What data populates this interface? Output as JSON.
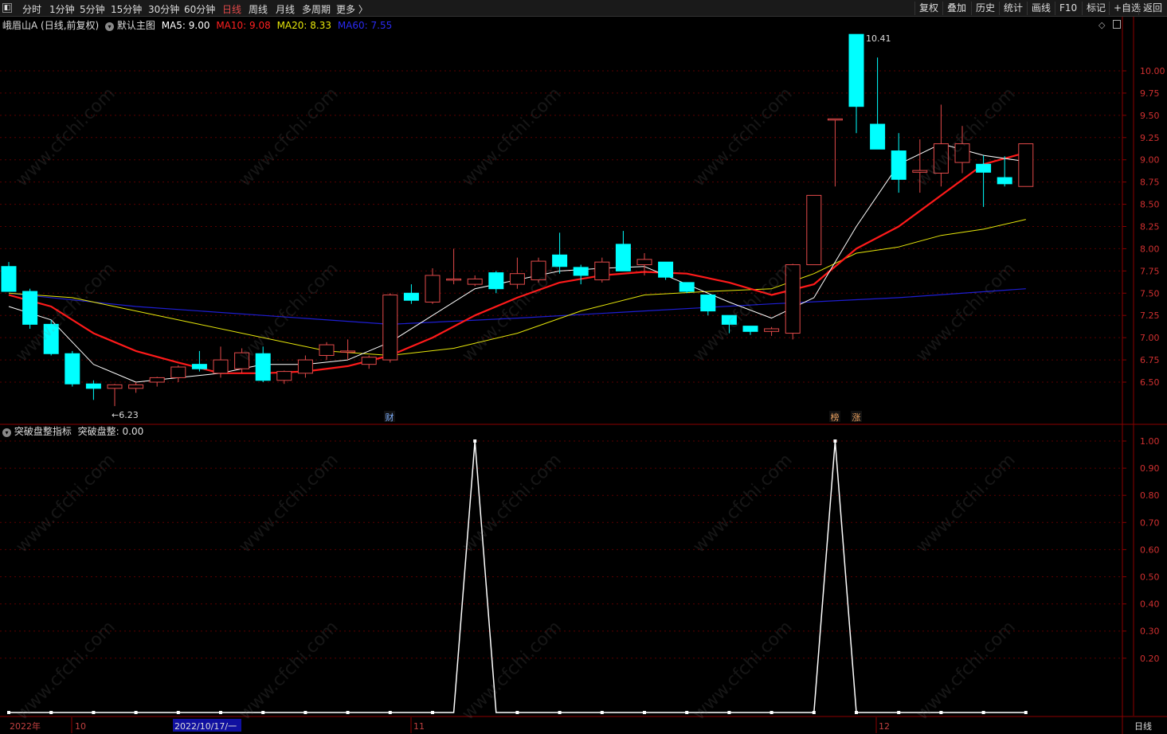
{
  "toolbar": {
    "left": [
      {
        "label": "分时",
        "active": false
      },
      {
        "label": "1分钟",
        "active": false
      },
      {
        "label": "5分钟",
        "active": false
      },
      {
        "label": "15分钟",
        "active": false
      },
      {
        "label": "30分钟",
        "active": false
      },
      {
        "label": "60分钟",
        "active": false
      },
      {
        "label": "日线",
        "active": true
      },
      {
        "label": "周线",
        "active": false
      },
      {
        "label": "月线",
        "active": false
      },
      {
        "label": "多周期",
        "active": false
      },
      {
        "label": "更多 〉",
        "active": false
      }
    ],
    "right": [
      "复权",
      "叠加",
      "历史",
      "统计",
      "画线",
      "F10",
      "标记",
      "+自选",
      "返回"
    ]
  },
  "main_legend": {
    "stock": "峨眉山A (日线,前复权)",
    "template": "默认主图",
    "ma5": "MA5: 9.00",
    "ma10": "MA10: 9.08",
    "ma20": "MA20: 8.33",
    "ma60": "MA60: 7.55"
  },
  "sub_legend": {
    "indicator": "突破盘整指标",
    "value": "突破盘整: 0.00"
  },
  "markers": {
    "cai": "财",
    "bang": "榜",
    "zhang": "涨"
  },
  "time_axis": {
    "year": "2022年",
    "m10": "10",
    "selected": "2022/10/17/一",
    "m11": "11",
    "m12": "12",
    "period": "日线"
  },
  "watermark": "www.cfchi.com",
  "colors": {
    "up": "#e34a4a",
    "down": "#00ffff",
    "ma5": "#ffffff",
    "ma10": "#ff1a1a",
    "ma20": "#e6e60a",
    "ma60": "#1e1ed2",
    "grid": "#5a0000",
    "axis_text": "#d03030"
  },
  "chart_data": {
    "type": "candlestick",
    "price_axis": {
      "ticks": [
        "10.00",
        "9.75",
        "9.50",
        "9.25",
        "9.00",
        "8.75",
        "8.50",
        "8.25",
        "8.00",
        "7.75",
        "7.50",
        "7.25",
        "7.00",
        "6.75",
        "6.50"
      ]
    },
    "annotations": {
      "high": "10.41",
      "low": "←6.23"
    },
    "candles": [
      [
        7.8,
        7.85,
        7.52,
        7.52
      ],
      [
        7.52,
        7.55,
        7.1,
        7.15
      ],
      [
        7.15,
        7.2,
        6.8,
        6.82
      ],
      [
        6.82,
        6.85,
        6.45,
        6.48
      ],
      [
        6.48,
        6.52,
        6.3,
        6.43
      ],
      [
        6.43,
        6.48,
        6.23,
        6.47
      ],
      [
        6.43,
        6.5,
        6.38,
        6.47
      ],
      [
        6.5,
        6.56,
        6.45,
        6.55
      ],
      [
        6.55,
        6.69,
        6.5,
        6.67
      ],
      [
        6.7,
        6.85,
        6.62,
        6.65
      ],
      [
        6.6,
        6.9,
        6.55,
        6.75
      ],
      [
        6.65,
        6.88,
        6.6,
        6.83
      ],
      [
        6.82,
        6.9,
        6.5,
        6.52
      ],
      [
        6.52,
        6.63,
        6.48,
        6.62
      ],
      [
        6.6,
        6.8,
        6.55,
        6.75
      ],
      [
        6.8,
        6.95,
        6.75,
        6.92
      ],
      [
        6.85,
        6.98,
        6.75,
        6.85
      ],
      [
        6.7,
        6.8,
        6.65,
        6.78
      ],
      [
        6.75,
        7.5,
        6.72,
        7.48
      ],
      [
        7.5,
        7.6,
        7.38,
        7.42
      ],
      [
        7.4,
        7.78,
        7.38,
        7.7
      ],
      [
        7.65,
        8.0,
        7.6,
        7.66
      ],
      [
        7.6,
        7.7,
        7.58,
        7.66
      ],
      [
        7.73,
        7.75,
        7.5,
        7.55
      ],
      [
        7.6,
        7.9,
        7.55,
        7.72
      ],
      [
        7.65,
        7.9,
        7.62,
        7.86
      ],
      [
        7.93,
        8.18,
        7.72,
        7.8
      ],
      [
        7.79,
        7.82,
        7.6,
        7.7
      ],
      [
        7.65,
        7.9,
        7.62,
        7.85
      ],
      [
        8.05,
        8.2,
        7.78,
        7.75
      ],
      [
        7.82,
        7.95,
        7.7,
        7.88
      ],
      [
        7.85,
        7.85,
        7.65,
        7.68
      ],
      [
        7.62,
        7.62,
        7.5,
        7.52
      ],
      [
        7.48,
        7.48,
        7.25,
        7.3
      ],
      [
        7.25,
        7.25,
        7.05,
        7.15
      ],
      [
        7.13,
        7.13,
        7.03,
        7.07
      ],
      [
        7.07,
        7.12,
        7.02,
        7.1
      ],
      [
        7.05,
        7.83,
        6.98,
        7.82
      ],
      [
        7.82,
        8.6,
        7.82,
        8.6
      ],
      [
        9.46,
        9.46,
        8.7,
        9.46
      ],
      [
        10.41,
        10.41,
        9.3,
        9.6
      ],
      [
        9.4,
        10.15,
        9.12,
        9.12
      ],
      [
        9.1,
        9.3,
        8.63,
        8.78
      ],
      [
        8.86,
        9.23,
        8.63,
        8.88
      ],
      [
        8.85,
        9.62,
        8.7,
        9.18
      ],
      [
        8.97,
        9.38,
        8.85,
        9.18
      ],
      [
        8.95,
        9.05,
        8.47,
        8.86
      ],
      [
        8.8,
        9.04,
        8.7,
        8.73
      ],
      [
        8.7,
        9.18,
        8.7,
        9.18
      ]
    ],
    "ma": {
      "ma5": [
        [
          0,
          7.35
        ],
        [
          2,
          7.2
        ],
        [
          4,
          6.7
        ],
        [
          6,
          6.5
        ],
        [
          8,
          6.55
        ],
        [
          10,
          6.6
        ],
        [
          12,
          6.7
        ],
        [
          14,
          6.7
        ],
        [
          16,
          6.75
        ],
        [
          18,
          6.95
        ],
        [
          20,
          7.25
        ],
        [
          22,
          7.55
        ],
        [
          24,
          7.65
        ],
        [
          26,
          7.75
        ],
        [
          28,
          7.78
        ],
        [
          30,
          7.8
        ],
        [
          32,
          7.6
        ],
        [
          34,
          7.4
        ],
        [
          36,
          7.22
        ],
        [
          38,
          7.45
        ],
        [
          40,
          8.25
        ],
        [
          42,
          8.95
        ],
        [
          44,
          9.18
        ],
        [
          46,
          9.05
        ],
        [
          48,
          8.98
        ]
      ],
      "ma10": [
        [
          0,
          7.48
        ],
        [
          2,
          7.35
        ],
        [
          4,
          7.05
        ],
        [
          6,
          6.85
        ],
        [
          8,
          6.72
        ],
        [
          10,
          6.6
        ],
        [
          12,
          6.6
        ],
        [
          14,
          6.62
        ],
        [
          16,
          6.68
        ],
        [
          18,
          6.8
        ],
        [
          20,
          7.0
        ],
        [
          22,
          7.25
        ],
        [
          24,
          7.45
        ],
        [
          26,
          7.62
        ],
        [
          28,
          7.7
        ],
        [
          30,
          7.74
        ],
        [
          32,
          7.72
        ],
        [
          34,
          7.62
        ],
        [
          36,
          7.48
        ],
        [
          38,
          7.6
        ],
        [
          40,
          8.0
        ],
        [
          42,
          8.25
        ],
        [
          44,
          8.6
        ],
        [
          46,
          8.95
        ],
        [
          48,
          9.08
        ]
      ],
      "ma20": [
        [
          0,
          7.5
        ],
        [
          3,
          7.45
        ],
        [
          6,
          7.3
        ],
        [
          9,
          7.15
        ],
        [
          12,
          7.0
        ],
        [
          15,
          6.85
        ],
        [
          18,
          6.8
        ],
        [
          21,
          6.88
        ],
        [
          24,
          7.05
        ],
        [
          27,
          7.3
        ],
        [
          30,
          7.48
        ],
        [
          33,
          7.52
        ],
        [
          36,
          7.55
        ],
        [
          38,
          7.72
        ],
        [
          40,
          7.95
        ],
        [
          42,
          8.02
        ],
        [
          44,
          8.15
        ],
        [
          46,
          8.22
        ],
        [
          48,
          8.33
        ]
      ],
      "ma60": [
        [
          0,
          7.5
        ],
        [
          6,
          7.35
        ],
        [
          12,
          7.25
        ],
        [
          18,
          7.15
        ],
        [
          24,
          7.22
        ],
        [
          30,
          7.3
        ],
        [
          36,
          7.38
        ],
        [
          42,
          7.45
        ],
        [
          48,
          7.55
        ]
      ]
    },
    "indicator": {
      "name": "突破盘整",
      "axis_ticks": [
        "1.00",
        "0.90",
        "0.80",
        "0.70",
        "0.60",
        "0.50",
        "0.40",
        "0.30",
        "0.20"
      ],
      "values": [
        0,
        0,
        0,
        0,
        0,
        0,
        0,
        0,
        0,
        0,
        0,
        0,
        0,
        0,
        0,
        0,
        0,
        0,
        0,
        0,
        0,
        0,
        1,
        0,
        0,
        0,
        0,
        0,
        0,
        0,
        0,
        0,
        0,
        0,
        0,
        0,
        0,
        0,
        0,
        1,
        0,
        0,
        0,
        0,
        0,
        0,
        0,
        0,
        0
      ]
    }
  }
}
